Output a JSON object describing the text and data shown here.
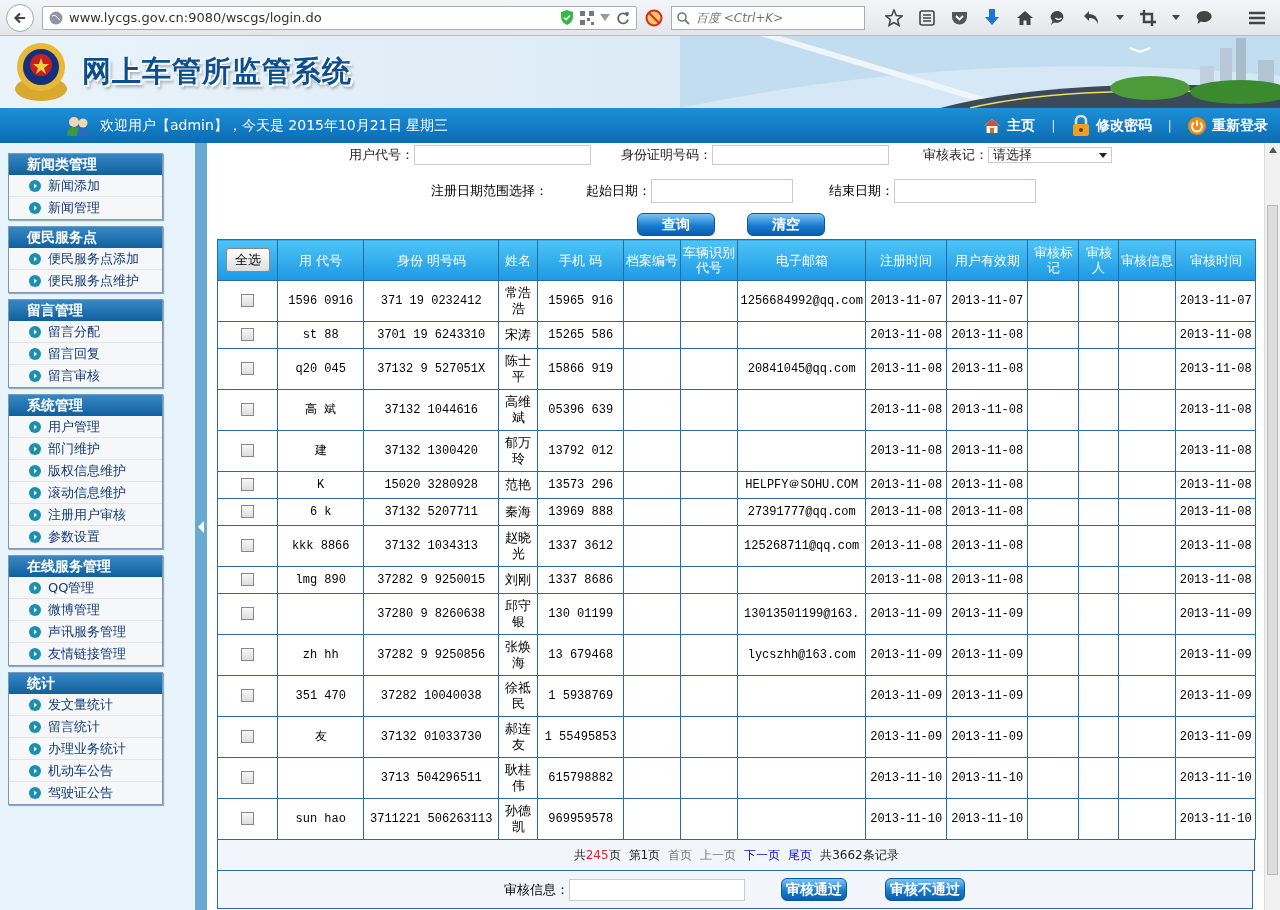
{
  "browser": {
    "url": "www.lycgs.gov.cn:9080/wscgs/login.do",
    "search_placeholder": "百度 <Ctrl+K>"
  },
  "header": {
    "title": "网上车管所监管系统",
    "welcome": "欢迎用户【admin】，今天是 2015年10月21日 星期三",
    "separator": "|",
    "links": [
      {
        "kind": "home",
        "label": "主页"
      },
      {
        "kind": "lock",
        "label": "修改密码"
      },
      {
        "kind": "power",
        "label": "重新登录"
      }
    ]
  },
  "sidebar": [
    {
      "title": "新闻类管理",
      "items": [
        "新闻添加",
        "新闻管理"
      ]
    },
    {
      "title": "便民服务点",
      "items": [
        "便民服务点添加",
        "便民服务点维护"
      ]
    },
    {
      "title": "留言管理",
      "items": [
        "留言分配",
        "留言回复",
        "留言审核"
      ]
    },
    {
      "title": "系统管理",
      "items": [
        "用户管理",
        "部门维护",
        "版权信息维护",
        "滚动信息维护",
        "注册用户审核",
        "参数设置"
      ]
    },
    {
      "title": "在线服务管理",
      "items": [
        "QQ管理",
        "微博管理",
        "声讯服务管理",
        "友情链接管理"
      ]
    },
    {
      "title": "统计",
      "items": [
        "发文量统计",
        "留言统计",
        "办理业务统计",
        "机动车公告",
        "驾驶证公告"
      ]
    }
  ],
  "filters": {
    "user_code_label": "用户代号：",
    "id_label": "身份证明号码：",
    "review_flag_label": "审核表记：",
    "review_flag_value": "请选择",
    "date_range_label": "注册日期范围选择：",
    "start_label": "起始日期：",
    "end_label": "结束日期："
  },
  "search_buttons": [
    "查询",
    "清空"
  ],
  "table": {
    "select_all": "全选",
    "columns": [
      "用 代号",
      "身份 明号码",
      "姓名",
      "手机 码",
      "档案编号",
      "车辆识别代号",
      "电子邮箱",
      "注册时间",
      "用户有效期",
      "审核标记",
      "审核人",
      "审核信息",
      "审核时间"
    ],
    "rows": [
      {
        "checked": false,
        "cells": [
          "1596 0916",
          "371 19 0232412",
          "常浩浩",
          "15965 916",
          null,
          null,
          "1256684992@qq.com",
          "2013-11-07",
          "2013-11-07",
          null,
          null,
          null,
          "2013-11-07"
        ]
      },
      {
        "checked": false,
        "cells": [
          "st 88",
          "3701 19 6243310",
          "宋涛",
          "15265 586",
          null,
          null,
          null,
          "2013-11-08",
          "2013-11-08",
          null,
          null,
          null,
          "2013-11-08"
        ]
      },
      {
        "checked": false,
        "cells": [
          "q20 045",
          "37132 9 527051X",
          "陈士平",
          "15866 919",
          null,
          null,
          "20841045@qq.com",
          "2013-11-08",
          "2013-11-08",
          null,
          null,
          null,
          "2013-11-08"
        ]
      },
      {
        "checked": false,
        "cells": [
          "高 斌",
          "37132 1044616",
          "高维斌",
          "05396 639",
          null,
          null,
          null,
          "2013-11-08",
          "2013-11-08",
          null,
          null,
          null,
          "2013-11-08"
        ]
      },
      {
        "checked": false,
        "cells": [
          "建",
          "37132 1300420",
          "郁万玲",
          "13792 012",
          null,
          null,
          null,
          "2013-11-08",
          "2013-11-08",
          null,
          null,
          null,
          "2013-11-08"
        ]
      },
      {
        "checked": false,
        "cells": [
          "K",
          "15020 3280928",
          "范艳",
          "13573 296",
          null,
          null,
          "HELPFY＠SOHU.COM",
          "2013-11-08",
          "2013-11-08",
          null,
          null,
          null,
          "2013-11-08"
        ]
      },
      {
        "checked": false,
        "cells": [
          "6 k",
          "37132 5207711",
          "秦海",
          "13969 888",
          null,
          null,
          "27391777@qq.com",
          "2013-11-08",
          "2013-11-08",
          null,
          null,
          null,
          "2013-11-08"
        ]
      },
      {
        "checked": false,
        "cells": [
          "kkk 8866",
          "37132 1034313",
          "赵晓光",
          "1337 3612",
          null,
          null,
          "125268711@qq.com",
          "2013-11-08",
          "2013-11-08",
          null,
          null,
          null,
          "2013-11-08"
        ]
      },
      {
        "checked": false,
        "cells": [
          "lmg 890",
          "37282 9 9250015",
          "刘刚",
          "1337 8686",
          null,
          null,
          null,
          "2013-11-08",
          "2013-11-08",
          null,
          null,
          null,
          "2013-11-08"
        ]
      },
      {
        "checked": false,
        "cells": [
          null,
          "37280 9 8260638",
          "邱守银",
          "130 01199",
          null,
          null,
          "13013501199@163.",
          "2013-11-09",
          "2013-11-09",
          null,
          null,
          null,
          "2013-11-09"
        ]
      },
      {
        "checked": false,
        "cells": [
          "zh hh",
          "37282 9 9250856",
          "张焕海",
          "13 679468",
          null,
          null,
          "lycszhh@163.com",
          "2013-11-09",
          "2013-11-09",
          null,
          null,
          null,
          "2013-11-09"
        ]
      },
      {
        "checked": false,
        "cells": [
          "351 470",
          "37282 10040038",
          "徐祗民",
          "1 5938769",
          null,
          null,
          null,
          "2013-11-09",
          "2013-11-09",
          null,
          null,
          null,
          "2013-11-09"
        ]
      },
      {
        "checked": false,
        "cells": [
          "友",
          "37132 01033730",
          "郝连友",
          "1 55495853",
          null,
          null,
          null,
          "2013-11-09",
          "2013-11-09",
          null,
          null,
          null,
          "2013-11-09"
        ]
      },
      {
        "checked": false,
        "cells": [
          null,
          "3713 504296511",
          "耿桂伟",
          "615798882",
          null,
          null,
          null,
          "2013-11-10",
          "2013-11-10",
          null,
          null,
          null,
          "2013-11-10"
        ]
      },
      {
        "checked": false,
        "cells": [
          "sun hao",
          "3711221 506263113",
          "孙德凯",
          "969959578",
          null,
          null,
          null,
          "2013-11-10",
          "2013-11-10",
          null,
          null,
          null,
          "2013-11-10"
        ]
      }
    ]
  },
  "pager": [
    {
      "kind": "total",
      "prefix": "共",
      "count": "245",
      "suffix": "页"
    },
    {
      "kind": "plain",
      "text": "第1页"
    },
    {
      "kind": "disabled",
      "text": "首页"
    },
    {
      "kind": "disabled",
      "text": "上一页"
    },
    {
      "kind": "link",
      "text": "下一页"
    },
    {
      "kind": "link",
      "text": "尾页"
    },
    {
      "kind": "plain",
      "text": "共3662条记录"
    }
  ],
  "review": {
    "label": "审核信息：",
    "buttons": [
      "审核通过",
      "审核不通过"
    ]
  }
}
